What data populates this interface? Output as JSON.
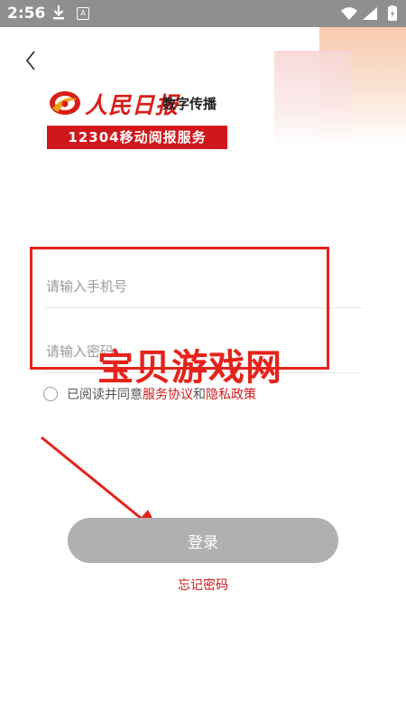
{
  "status_bar": {
    "time": "2:56",
    "notification_icon": "A"
  },
  "header": {
    "back_icon": "chevron-left-icon"
  },
  "brand": {
    "name": "人民日报",
    "subtitle": "数字传播",
    "service": "12304移动阅报服务",
    "logo_color": "#d91e18"
  },
  "form": {
    "phone_placeholder": "请输入手机号",
    "password_placeholder": "请输入密码"
  },
  "agreement": {
    "prefix": "已阅读并同意",
    "service_link": "服务协议",
    "conjunction": "和",
    "privacy_link": "隐私政策"
  },
  "login_button": "登录",
  "forgot_password": "忘记密码",
  "watermark": "宝贝游戏网",
  "colors": {
    "accent": "#d0181b",
    "button_disabled": "#b0b0b0",
    "status_bar": "#8f8f8f"
  }
}
